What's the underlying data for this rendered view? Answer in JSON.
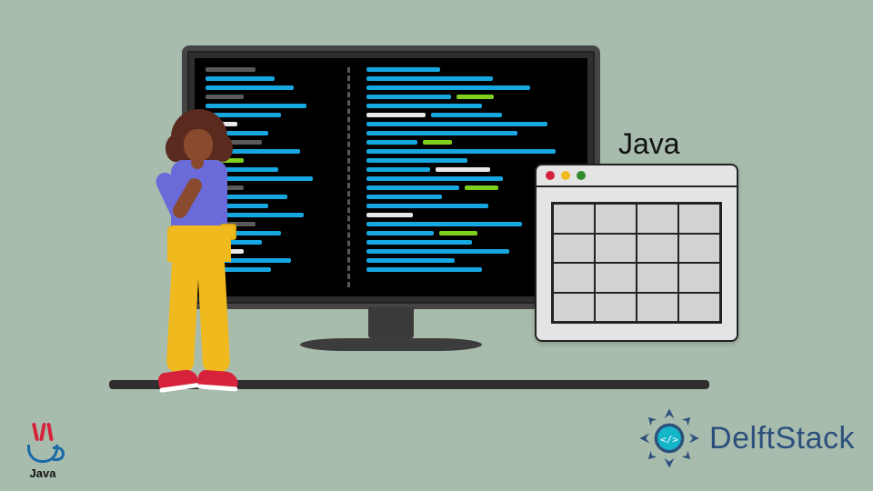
{
  "labels": {
    "java_label": "Java",
    "java_logo_text": "Java",
    "brand": "DelftStack"
  },
  "icons": {
    "java_logo": "java-logo-icon",
    "delft_badge": "delftstack-badge-icon",
    "window_close": "close-dot-icon",
    "window_min": "minimize-dot-icon",
    "window_max": "maximize-dot-icon"
  },
  "colors": {
    "bg": "#a8bcad",
    "code_blue": "#17a7e0",
    "code_green": "#7fd01e",
    "code_white": "#e8e8e8",
    "accent_red": "#d6233b",
    "accent_yellow": "#f0b91e",
    "brand_blue": "#2c4f7c"
  },
  "app_window": {
    "grid_rows": 4,
    "grid_cols": 4
  }
}
